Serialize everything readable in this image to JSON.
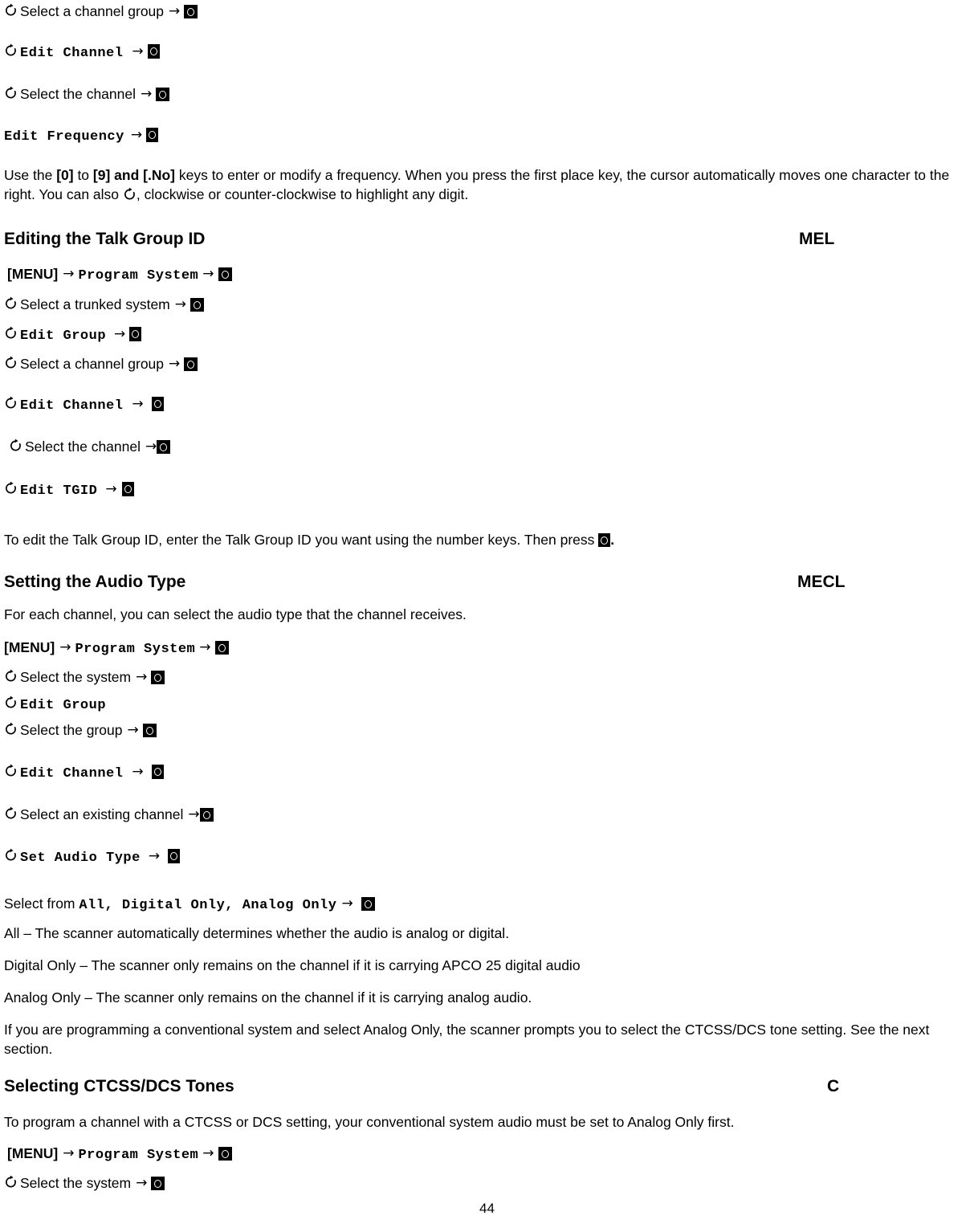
{
  "document": {
    "page_number": "44"
  },
  "icons": {
    "rotate_knob": "rotate-knob-icon",
    "select_key": "select-key-icon",
    "arrow": "→"
  },
  "top_steps": [
    {
      "knob": true,
      "text": "Select a channel group",
      "mono": false,
      "arrow": "→",
      "key": true
    },
    {
      "knob": true,
      "text": "Edit Channel",
      "mono": true,
      "arrow": "→",
      "key": true
    },
    {
      "knob": true,
      "text": "Select the channel",
      "mono": false,
      "arrow": "→",
      "key": true
    },
    {
      "knob": false,
      "text": "Edit Frequency",
      "mono": true,
      "arrow": "→",
      "key": true
    }
  ],
  "frequency_paragraph": {
    "part1": "Use the ",
    "key1": "[0]",
    "part2": " to ",
    "key2": "[9] and [.No]",
    "part3": " keys to enter or modify a frequency. When you press the first place key, the cursor automatically moves one character to the right. You can also ",
    "part4": ", clockwise or counter-clockwise to highlight any digit."
  },
  "sections": [
    {
      "id": "editing-talk-group-id",
      "title": "Editing the Talk Group ID",
      "marker": "MEL",
      "steps": [
        {
          "knob": false,
          "prefix": "[MENU]",
          "prefix_bold": true,
          "arrow1": "→",
          "text": "Program System",
          "mono": true,
          "arrow": "→",
          "key": true
        },
        {
          "knob": true,
          "text": "Select a trunked system",
          "mono": false,
          "arrow": "→",
          "key": true
        },
        {
          "knob": true,
          "text": "Edit Group",
          "mono": true,
          "arrow": "→",
          "key": true
        },
        {
          "knob": true,
          "text": "Select a channel group",
          "mono": false,
          "arrow": "→",
          "key": true
        },
        {
          "knob": true,
          "text": "Edit Channel",
          "mono": true,
          "arrow": "→",
          "key": true
        },
        {
          "knob": true,
          "text": "Select the channel",
          "mono": false,
          "arrow": "→",
          "key": true
        },
        {
          "knob": true,
          "text": "Edit TGID",
          "mono": true,
          "arrow": "→",
          "key": true
        }
      ],
      "body": {
        "part1": "To edit the Talk Group ID, enter the Talk Group ID you want using the number keys. Then press ",
        "part2": "."
      }
    },
    {
      "id": "setting-the-audio-type",
      "title": "Setting the Audio Type",
      "marker": "MECL",
      "intro": "For each channel, you can select the audio type that the channel receives.",
      "steps": [
        {
          "knob": false,
          "prefix": "[MENU]",
          "prefix_bold": true,
          "arrow1": "→",
          "text": "Program System",
          "mono": true,
          "arrow": "→",
          "key": true
        },
        {
          "knob": true,
          "text": "Select the system",
          "mono": false,
          "arrow": "→",
          "key": true
        },
        {
          "knob": true,
          "text": "Edit Group",
          "mono": true,
          "arrow": "",
          "key": false
        },
        {
          "knob": true,
          "text": "Select the group",
          "mono": false,
          "arrow": "→",
          "key": true
        },
        {
          "knob": true,
          "text": "Edit Channel",
          "mono": true,
          "arrow": "→",
          "key": true
        },
        {
          "knob": true,
          "text": "Select an existing channel",
          "mono": false,
          "arrow": "→",
          "key": true
        },
        {
          "knob": true,
          "text": "Set Audio Type",
          "mono": true,
          "arrow": "→",
          "key": true
        }
      ],
      "select_from": {
        "label": "Select from ",
        "options": "All, Digital Only, Analog Only",
        "arrow": "→"
      },
      "definitions": [
        "All – The scanner automatically determines whether the audio is analog or digital.",
        "Digital Only – The scanner only remains on the channel if it is carrying APCO 25 digital audio",
        "Analog Only – The scanner only remains on the channel if it is carrying analog audio."
      ],
      "note": "If you are programming a conventional system and select Analog Only, the scanner prompts you to select the CTCSS/DCS tone setting. See the next section."
    },
    {
      "id": "selecting-ctcss-dcs-tones",
      "title": "Selecting CTCSS/DCS Tones",
      "marker": "C",
      "intro": "To program a channel with a CTCSS or DCS setting, your conventional system audio must be set to Analog Only first.",
      "steps": [
        {
          "knob": false,
          "prefix": "[MENU]",
          "prefix_bold": true,
          "arrow1": "→",
          "text": "Program System",
          "mono": true,
          "arrow": "→",
          "key": true
        },
        {
          "knob": true,
          "text": "Select the system",
          "mono": false,
          "arrow": "→",
          "key": true
        }
      ]
    }
  ]
}
